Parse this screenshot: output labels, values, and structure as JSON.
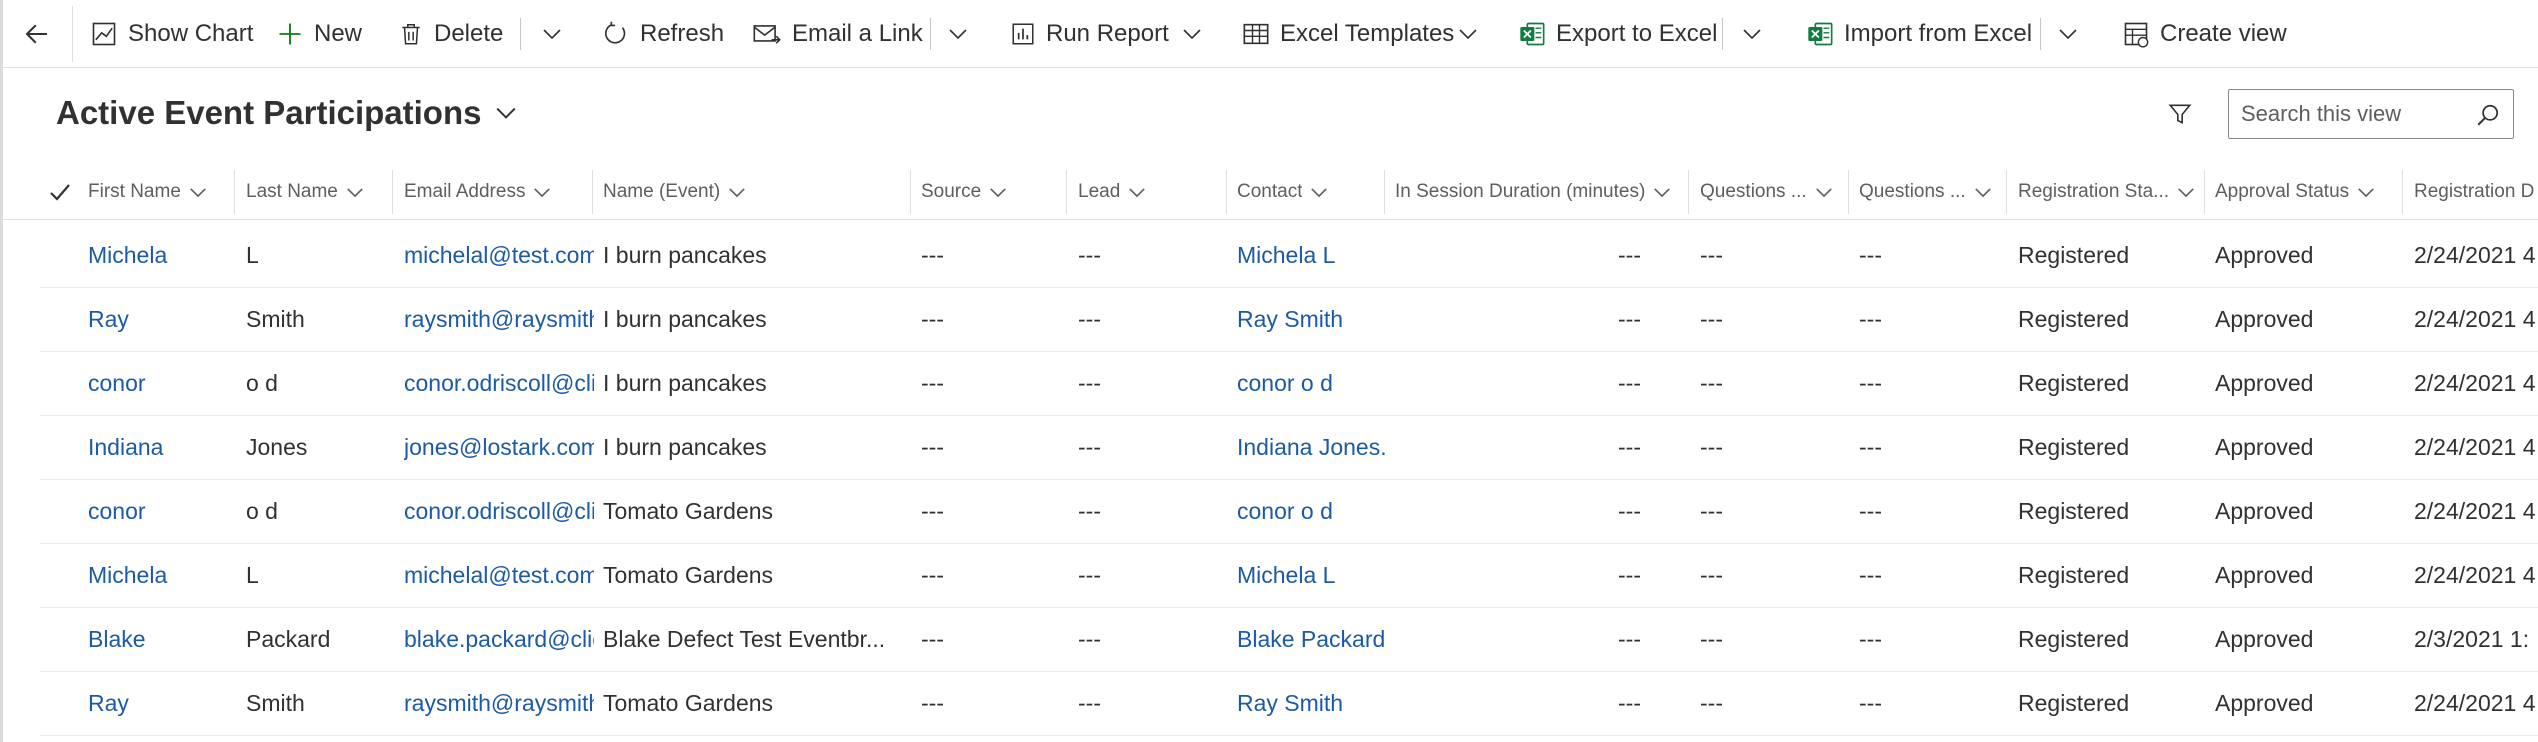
{
  "toolbar": {
    "show_chart": "Show Chart",
    "new": "New",
    "delete": "Delete",
    "refresh": "Refresh",
    "email_link": "Email a Link",
    "run_report": "Run Report",
    "excel_templates": "Excel Templates",
    "export_excel": "Export to Excel",
    "import_excel": "Import from Excel",
    "create_view": "Create view"
  },
  "view": {
    "title": "Active Event Participations",
    "search_placeholder": "Search this view"
  },
  "columns": [
    "First Name",
    "Last Name",
    "Email Address",
    "Name (Event)",
    "Source",
    "Lead",
    "Contact",
    "In Session Duration (minutes)",
    "Questions ...",
    "Questions ...",
    "Registration Sta...",
    "Approval Status",
    "Registration D"
  ],
  "rows": [
    {
      "first": "Michela",
      "last": "L",
      "email": "michelal@test.com",
      "event": "I burn pancakes",
      "source": "---",
      "lead": "---",
      "contact": "Michela L",
      "duration": "---",
      "q1": "---",
      "q2": "---",
      "reg_status": "Registered",
      "approval": "Approved",
      "reg_date": "2/24/2021 4"
    },
    {
      "first": "Ray",
      "last": "Smith",
      "email": "raysmith@raysmith",
      "event": "I burn pancakes",
      "source": "---",
      "lead": "---",
      "contact": "Ray Smith",
      "duration": "---",
      "q1": "---",
      "q2": "---",
      "reg_status": "Registered",
      "approval": "Approved",
      "reg_date": "2/24/2021 4"
    },
    {
      "first": "conor",
      "last": "o d",
      "email": "conor.odriscoll@cli",
      "event": "I burn pancakes",
      "source": "---",
      "lead": "---",
      "contact": "conor o d",
      "duration": "---",
      "q1": "---",
      "q2": "---",
      "reg_status": "Registered",
      "approval": "Approved",
      "reg_date": "2/24/2021 4"
    },
    {
      "first": "Indiana",
      "last": "Jones",
      "email": "jones@lostark.com",
      "event": "I burn pancakes",
      "source": "---",
      "lead": "---",
      "contact": "Indiana Jones..",
      "duration": "---",
      "q1": "---",
      "q2": "---",
      "reg_status": "Registered",
      "approval": "Approved",
      "reg_date": "2/24/2021 4"
    },
    {
      "first": "conor",
      "last": "o d",
      "email": "conor.odriscoll@cli",
      "event": "Tomato Gardens",
      "source": "---",
      "lead": "---",
      "contact": "conor o d",
      "duration": "---",
      "q1": "---",
      "q2": "---",
      "reg_status": "Registered",
      "approval": "Approved",
      "reg_date": "2/24/2021 4"
    },
    {
      "first": "Michela",
      "last": "L",
      "email": "michelal@test.com",
      "event": "Tomato Gardens",
      "source": "---",
      "lead": "---",
      "contact": "Michela L",
      "duration": "---",
      "q1": "---",
      "q2": "---",
      "reg_status": "Registered",
      "approval": "Approved",
      "reg_date": "2/24/2021 4"
    },
    {
      "first": "Blake",
      "last": "Packard",
      "email": "blake.packard@clic",
      "event": "Blake Defect Test Eventbr...",
      "source": "---",
      "lead": "---",
      "contact": "Blake Packard..",
      "duration": "---",
      "q1": "---",
      "q2": "---",
      "reg_status": "Registered",
      "approval": "Approved",
      "reg_date": "2/3/2021 1:"
    },
    {
      "first": "Ray",
      "last": "Smith",
      "email": "raysmith@raysmith",
      "event": "Tomato Gardens",
      "source": "---",
      "lead": "---",
      "contact": "Ray Smith",
      "duration": "---",
      "q1": "---",
      "q2": "---",
      "reg_status": "Registered",
      "approval": "Approved",
      "reg_date": "2/24/2021 4"
    }
  ]
}
